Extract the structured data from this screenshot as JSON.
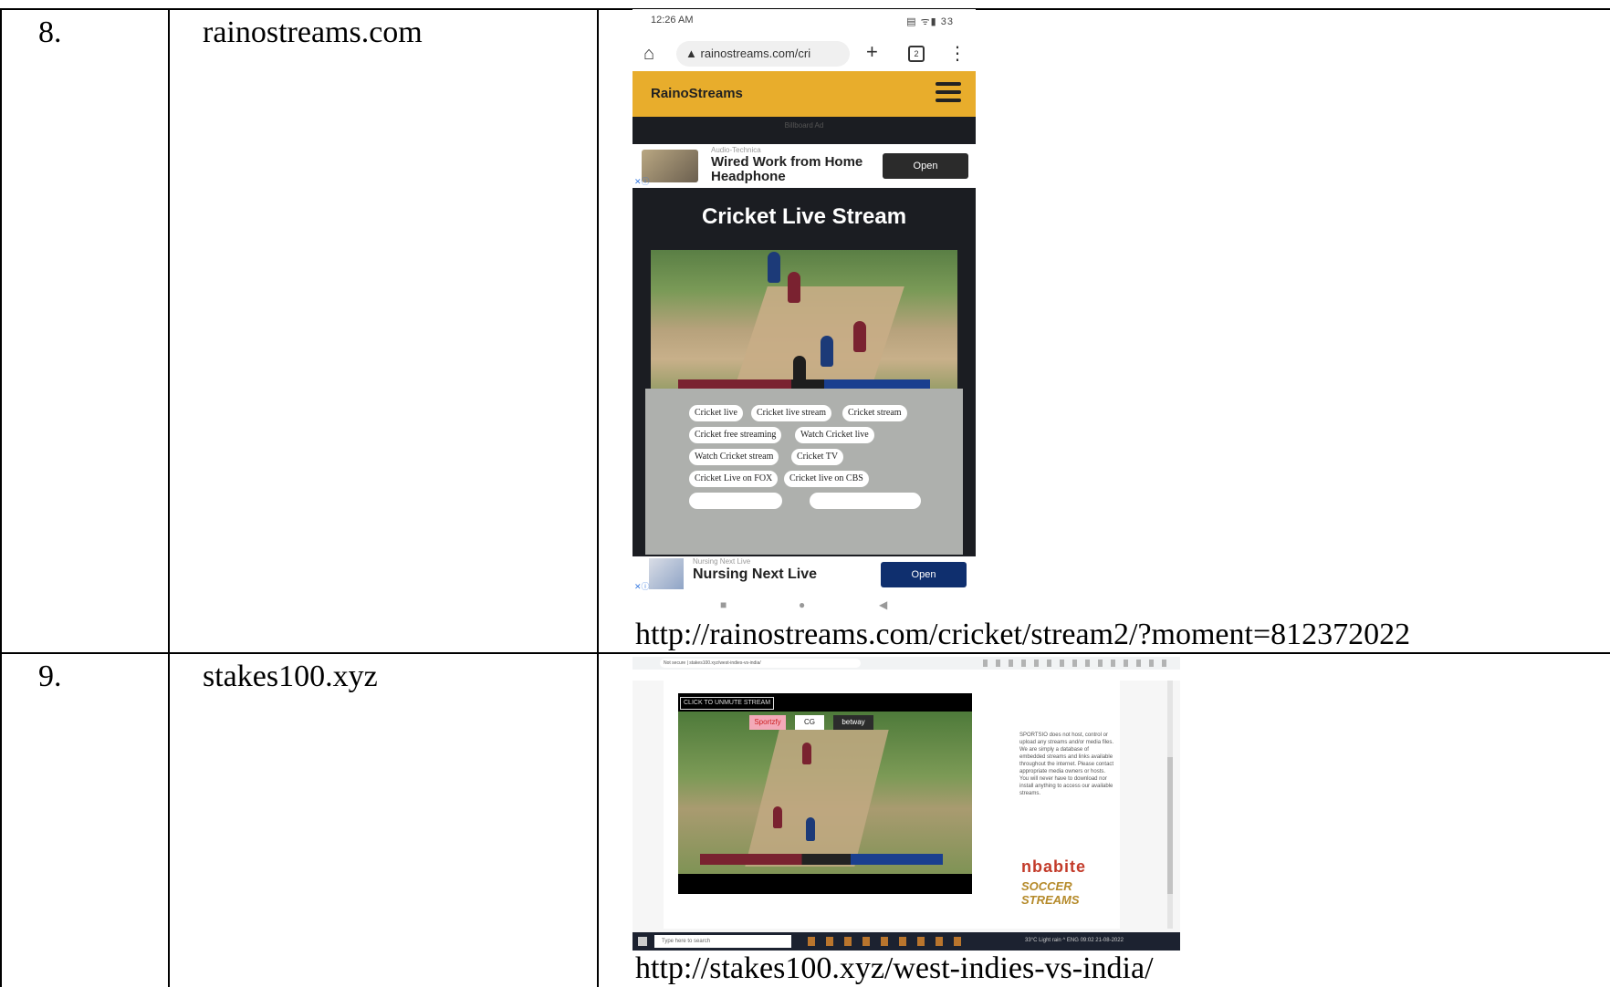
{
  "rows": [
    {
      "number": "8.",
      "site": "rainostreams.com",
      "url": "http://rainostreams.com/cricket/stream2/?moment=812372022",
      "screenshot": {
        "status_time": "12:26 AM",
        "status_icons": "▤ ᯤ▮ 33",
        "address": "rainostreams.com/cri",
        "tab_count": "2",
        "brand": "RainoStreams",
        "billboard": "Billboard Ad",
        "ad1_source": "Audio-Technica",
        "ad1_title": "Wired Work from Home Headphone",
        "open_label": "Open",
        "stream_title": "Cricket Live Stream",
        "tags": [
          "Cricket live",
          "Cricket live stream",
          "Cricket stream",
          "Cricket free streaming",
          "Watch Cricket live",
          "Watch Cricket stream",
          "Cricket TV",
          "Cricket Live on FOX",
          "Cricket live on CBS"
        ],
        "ad2_source": "Nursing Next Live",
        "ad2_title": "Nursing Next Live",
        "ad2_open_label": "Open"
      }
    },
    {
      "number": "9.",
      "site": "stakes100.xyz",
      "url": "http://stakes100.xyz/west-indies-vs-india/",
      "screenshot": {
        "address": "Not secure | stakes100.xyz/west-indies-vs-india/",
        "banner": "CLICK TO UNMUTE STREAM",
        "brand1": "Sportzfy",
        "brand2": "CG",
        "brand3": "betway",
        "sidebar_text": "SPORTSIO does not host, control or upload any streams and/or media files. We are simply a database of embedded streams and links available throughout the internet. Please contact appropriate media owners or hosts. You will never have to download nor install anything to access our available streams.",
        "logo_line1": "nbabite",
        "logo_line2": "SOCCER STREAMS",
        "taskbar_search": "Type here to search",
        "tray": "33°C Light rain  ^  ENG  09:02 21-08-2022"
      }
    }
  ]
}
